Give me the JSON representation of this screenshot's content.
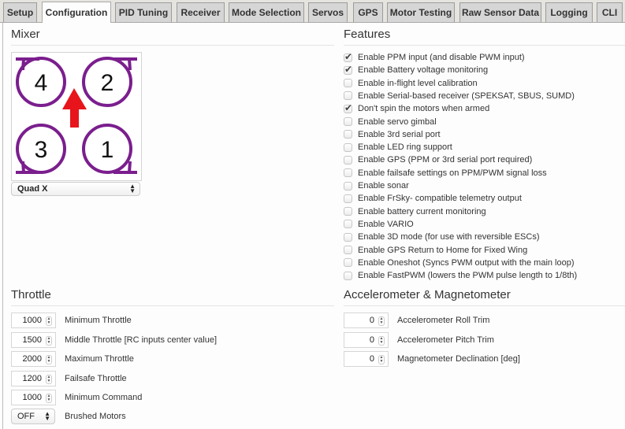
{
  "tabs": [
    {
      "label": "Setup",
      "active": false
    },
    {
      "label": "Configuration",
      "active": true
    },
    {
      "label": "PID Tuning",
      "active": false
    },
    {
      "label": "Receiver",
      "active": false
    },
    {
      "label": "Mode Selection",
      "active": false
    },
    {
      "label": "Servos",
      "active": false
    },
    {
      "label": "GPS",
      "active": false
    },
    {
      "label": "Motor Testing",
      "active": false
    },
    {
      "label": "Raw Sensor Data",
      "active": false
    },
    {
      "label": "Logging",
      "active": false
    },
    {
      "label": "CLI",
      "active": false
    }
  ],
  "mixer": {
    "title": "Mixer",
    "motors": [
      "4",
      "2",
      "3",
      "1"
    ],
    "type_selected": "Quad X",
    "colors": {
      "prop": "#7b1e8e",
      "arrow": "#e8141b"
    }
  },
  "features": {
    "title": "Features",
    "items": [
      {
        "label": "Enable PPM input (and disable PWM input)",
        "checked": true
      },
      {
        "label": "Enable Battery voltage monitoring",
        "checked": true
      },
      {
        "label": "Enable in-flight level calibration",
        "checked": false
      },
      {
        "label": "Enable Serial-based receiver (SPEKSAT, SBUS, SUMD)",
        "checked": false
      },
      {
        "label": "Don't spin the motors when armed",
        "checked": true
      },
      {
        "label": "Enable servo gimbal",
        "checked": false
      },
      {
        "label": "Enable 3rd serial port",
        "checked": false
      },
      {
        "label": "Enable LED ring support",
        "checked": false
      },
      {
        "label": "Enable GPS (PPM or 3rd serial port required)",
        "checked": false
      },
      {
        "label": "Enable failsafe settings on PPM/PWM signal loss",
        "checked": false
      },
      {
        "label": "Enable sonar",
        "checked": false
      },
      {
        "label": "Enable FrSky- compatible telemetry output",
        "checked": false
      },
      {
        "label": "Enable battery current monitoring",
        "checked": false
      },
      {
        "label": "Enable VARIO",
        "checked": false
      },
      {
        "label": "Enable 3D mode (for use with reversible ESCs)",
        "checked": false
      },
      {
        "label": "Enable GPS Return to Home for Fixed Wing",
        "checked": false
      },
      {
        "label": "Enable Oneshot (Syncs PWM output with the main loop)",
        "checked": false
      },
      {
        "label": "Enable FastPWM (lowers the PWM pulse length to 1/8th)",
        "checked": false
      }
    ]
  },
  "throttle": {
    "title": "Throttle",
    "fields": [
      {
        "value": "1000",
        "label": "Minimum Throttle"
      },
      {
        "value": "1500",
        "label": "Middle Throttle [RC inputs center value]"
      },
      {
        "value": "2000",
        "label": "Maximum Throttle"
      },
      {
        "value": "1200",
        "label": "Failsafe Throttle"
      },
      {
        "value": "1000",
        "label": "Minimum Command"
      }
    ],
    "brushed": {
      "value": "OFF",
      "label": "Brushed Motors"
    }
  },
  "accel": {
    "title": "Accelerometer & Magnetometer",
    "fields": [
      {
        "value": "0",
        "label": "Accelerometer Roll Trim"
      },
      {
        "value": "0",
        "label": "Accelerometer Pitch Trim"
      },
      {
        "value": "0",
        "label": "Magnetometer Declination [deg]"
      }
    ]
  }
}
